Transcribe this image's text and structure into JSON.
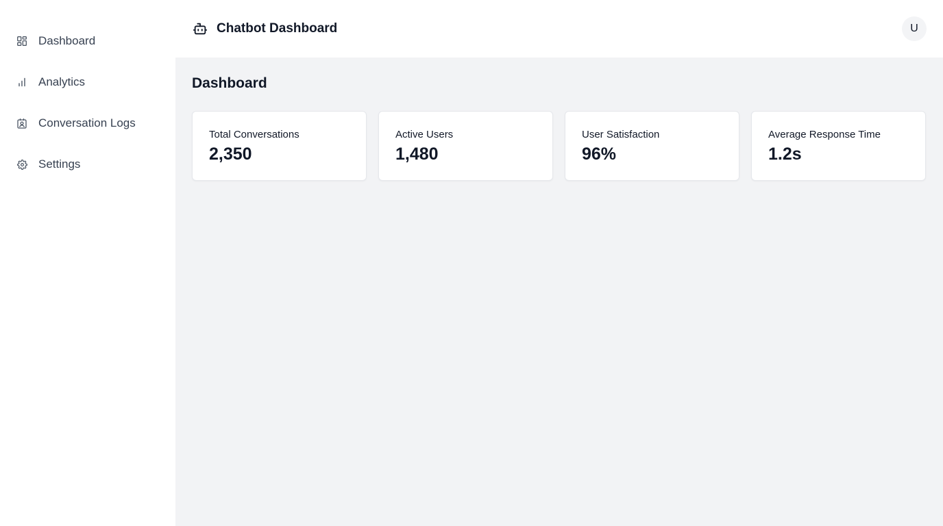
{
  "sidebar": {
    "items": [
      {
        "label": "Dashboard",
        "icon": "dashboard-grid-icon"
      },
      {
        "label": "Analytics",
        "icon": "bar-chart-icon"
      },
      {
        "label": "Conversation Logs",
        "icon": "contact-log-icon"
      },
      {
        "label": "Settings",
        "icon": "gear-icon"
      }
    ]
  },
  "header": {
    "title": "Chatbot Dashboard",
    "logo_icon": "bot-icon",
    "avatar_initial": "U"
  },
  "main": {
    "page_title": "Dashboard",
    "stats": [
      {
        "label": "Total Conversations",
        "value": "2,350"
      },
      {
        "label": "Active Users",
        "value": "1,480"
      },
      {
        "label": "User Satisfaction",
        "value": "96%"
      },
      {
        "label": "Average Response Time",
        "value": "1.2s"
      }
    ]
  },
  "colors": {
    "main_background": "#f2f3f5",
    "card_background": "#ffffff",
    "text_primary": "#111827",
    "text_nav": "#374151"
  }
}
